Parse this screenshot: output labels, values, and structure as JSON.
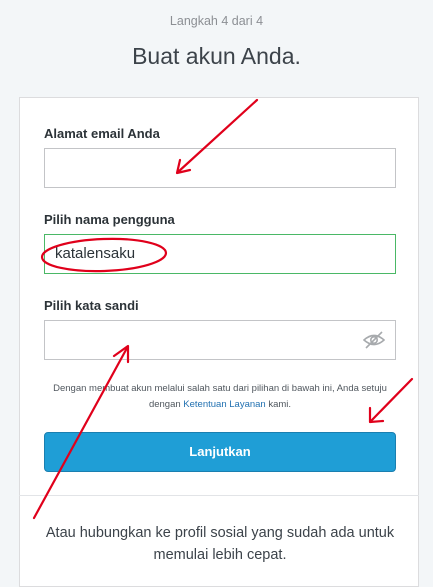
{
  "header": {
    "step": "Langkah 4 dari 4",
    "title": "Buat akun Anda."
  },
  "form": {
    "email_label": "Alamat email Anda",
    "email_value": "",
    "username_label": "Pilih nama pengguna",
    "username_value": "katalensaku",
    "password_label": "Pilih kata sandi",
    "password_value": ""
  },
  "terms": {
    "before": "Dengan membuat akun melalui salah satu dari pilihan di bawah ini, Anda setuju dengan ",
    "link": "Ketentuan Layanan",
    "after": " kami."
  },
  "submit_label": "Lanjutkan",
  "social": {
    "text": "Atau hubungkan ke profil sosial yang sudah ada untuk memulai lebih cepat."
  },
  "icons": {
    "password_toggle": "eye-slash-icon"
  },
  "colors": {
    "button": "#1f9ed6",
    "valid_border": "#4ab866",
    "annotation": "#e0001b",
    "link": "#2271b1"
  }
}
